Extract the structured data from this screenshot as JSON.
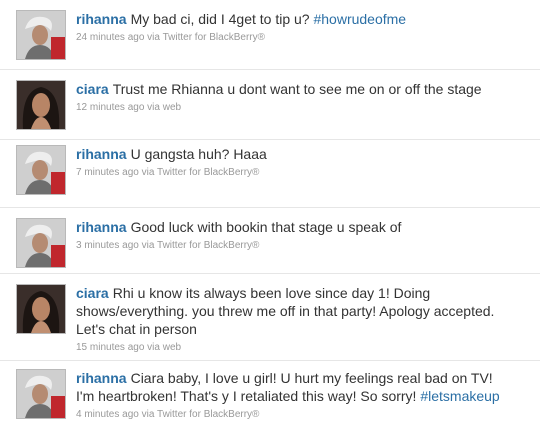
{
  "tweets": [
    {
      "user": "rihanna",
      "text": "My bad ci, did I 4get to tip u?",
      "hashtag": "#howrudeofme",
      "time": "24 minutes ago",
      "via": "via",
      "source": "Twitter for BlackBerry®",
      "avatar": "rihanna-avatar"
    },
    {
      "user": "ciara",
      "text": "Trust me Rhianna u dont want to see me on or off the stage",
      "hashtag": "",
      "time": "12 minutes ago",
      "via": "via",
      "source": "web",
      "avatar": "ciara-avatar"
    },
    {
      "user": "rihanna",
      "text": "U gangsta huh? Haaa",
      "hashtag": "",
      "time": "7 minutes ago",
      "via": "via",
      "source": "Twitter for BlackBerry®",
      "avatar": "rihanna-avatar"
    },
    {
      "user": "rihanna",
      "text": "Good luck with bookin that stage u speak of",
      "hashtag": "",
      "time": "3 minutes ago",
      "via": "via",
      "source": "Twitter for BlackBerry®",
      "avatar": "rihanna-avatar"
    },
    {
      "user": "ciara",
      "text": "Rhi u know its always been love since day 1! Doing shows/everything. you threw me off in that party! Apology accepted. Let's chat in person",
      "hashtag": "",
      "time": "15 minutes ago",
      "via": "via",
      "source": "web",
      "avatar": "ciara-avatar"
    },
    {
      "user": "rihanna",
      "text": "Ciara baby, I love u girl! U hurt my feelings real bad on TV! I'm heartbroken! That's y I retaliated this way! So sorry!",
      "hashtag": "#letsmakeup",
      "time": "4 minutes ago",
      "via": "via",
      "source": "Twitter for BlackBerry®",
      "avatar": "rihanna-avatar"
    }
  ],
  "colors": {
    "link": "#2b6fa5",
    "text": "#333333",
    "meta": "#999999"
  }
}
